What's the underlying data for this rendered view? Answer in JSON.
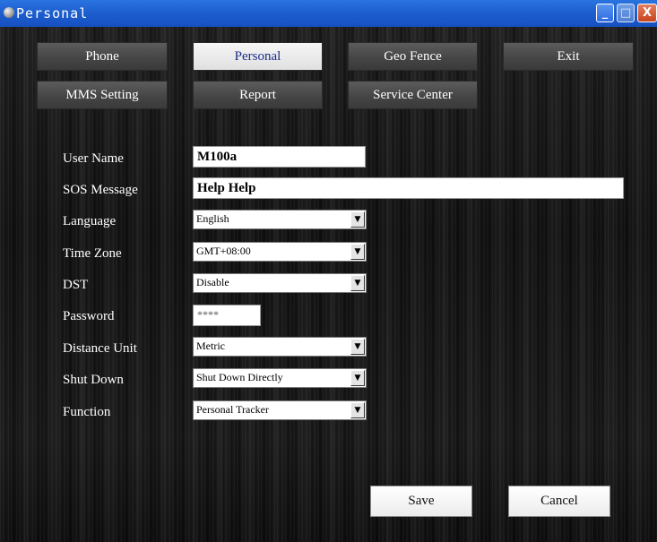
{
  "window": {
    "title": "Personal",
    "minimize_glyph": "_",
    "maximize_glyph": "□",
    "close_glyph": "X"
  },
  "nav": {
    "phone": "Phone",
    "personal": "Personal",
    "geo_fence": "Geo Fence",
    "exit": "Exit",
    "mms_setting": "MMS Setting",
    "report": "Report",
    "service_center": "Service Center"
  },
  "form": {
    "user_name": {
      "label": "User Name",
      "value": "M100a"
    },
    "sos_message": {
      "label": "SOS Message",
      "value": "Help Help"
    },
    "language": {
      "label": "Language",
      "value": "English"
    },
    "time_zone": {
      "label": "Time Zone",
      "value": "GMT+08:00"
    },
    "dst": {
      "label": "DST",
      "value": "Disable"
    },
    "password": {
      "label": "Password",
      "value": "****"
    },
    "distance_unit": {
      "label": "Distance Unit",
      "value": "Metric"
    },
    "shut_down": {
      "label": "Shut Down",
      "value": "Shut Down Directly"
    },
    "function": {
      "label": "Function",
      "value": "Personal Tracker"
    }
  },
  "actions": {
    "save": "Save",
    "cancel": "Cancel"
  },
  "icons": {
    "app": "app-icon",
    "dropdown": "chevron-down-icon"
  }
}
